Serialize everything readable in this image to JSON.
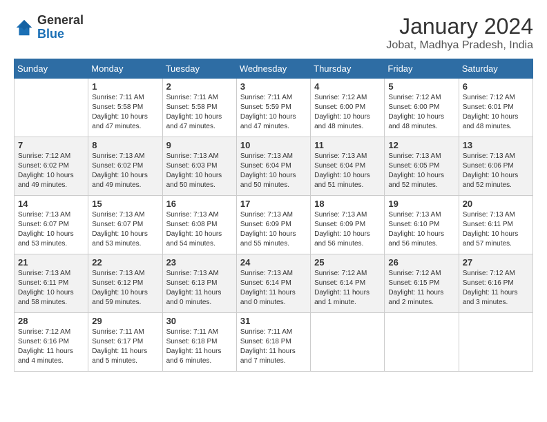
{
  "header": {
    "logo_general": "General",
    "logo_blue": "Blue",
    "month_title": "January 2024",
    "subtitle": "Jobat, Madhya Pradesh, India"
  },
  "days_of_week": [
    "Sunday",
    "Monday",
    "Tuesday",
    "Wednesday",
    "Thursday",
    "Friday",
    "Saturday"
  ],
  "weeks": [
    [
      {
        "day": "",
        "info": ""
      },
      {
        "day": "1",
        "info": "Sunrise: 7:11 AM\nSunset: 5:58 PM\nDaylight: 10 hours\nand 47 minutes."
      },
      {
        "day": "2",
        "info": "Sunrise: 7:11 AM\nSunset: 5:58 PM\nDaylight: 10 hours\nand 47 minutes."
      },
      {
        "day": "3",
        "info": "Sunrise: 7:11 AM\nSunset: 5:59 PM\nDaylight: 10 hours\nand 47 minutes."
      },
      {
        "day": "4",
        "info": "Sunrise: 7:12 AM\nSunset: 6:00 PM\nDaylight: 10 hours\nand 48 minutes."
      },
      {
        "day": "5",
        "info": "Sunrise: 7:12 AM\nSunset: 6:00 PM\nDaylight: 10 hours\nand 48 minutes."
      },
      {
        "day": "6",
        "info": "Sunrise: 7:12 AM\nSunset: 6:01 PM\nDaylight: 10 hours\nand 48 minutes."
      }
    ],
    [
      {
        "day": "7",
        "info": "Sunrise: 7:12 AM\nSunset: 6:02 PM\nDaylight: 10 hours\nand 49 minutes."
      },
      {
        "day": "8",
        "info": "Sunrise: 7:13 AM\nSunset: 6:02 PM\nDaylight: 10 hours\nand 49 minutes."
      },
      {
        "day": "9",
        "info": "Sunrise: 7:13 AM\nSunset: 6:03 PM\nDaylight: 10 hours\nand 50 minutes."
      },
      {
        "day": "10",
        "info": "Sunrise: 7:13 AM\nSunset: 6:04 PM\nDaylight: 10 hours\nand 50 minutes."
      },
      {
        "day": "11",
        "info": "Sunrise: 7:13 AM\nSunset: 6:04 PM\nDaylight: 10 hours\nand 51 minutes."
      },
      {
        "day": "12",
        "info": "Sunrise: 7:13 AM\nSunset: 6:05 PM\nDaylight: 10 hours\nand 52 minutes."
      },
      {
        "day": "13",
        "info": "Sunrise: 7:13 AM\nSunset: 6:06 PM\nDaylight: 10 hours\nand 52 minutes."
      }
    ],
    [
      {
        "day": "14",
        "info": "Sunrise: 7:13 AM\nSunset: 6:07 PM\nDaylight: 10 hours\nand 53 minutes."
      },
      {
        "day": "15",
        "info": "Sunrise: 7:13 AM\nSunset: 6:07 PM\nDaylight: 10 hours\nand 53 minutes."
      },
      {
        "day": "16",
        "info": "Sunrise: 7:13 AM\nSunset: 6:08 PM\nDaylight: 10 hours\nand 54 minutes."
      },
      {
        "day": "17",
        "info": "Sunrise: 7:13 AM\nSunset: 6:09 PM\nDaylight: 10 hours\nand 55 minutes."
      },
      {
        "day": "18",
        "info": "Sunrise: 7:13 AM\nSunset: 6:09 PM\nDaylight: 10 hours\nand 56 minutes."
      },
      {
        "day": "19",
        "info": "Sunrise: 7:13 AM\nSunset: 6:10 PM\nDaylight: 10 hours\nand 56 minutes."
      },
      {
        "day": "20",
        "info": "Sunrise: 7:13 AM\nSunset: 6:11 PM\nDaylight: 10 hours\nand 57 minutes."
      }
    ],
    [
      {
        "day": "21",
        "info": "Sunrise: 7:13 AM\nSunset: 6:11 PM\nDaylight: 10 hours\nand 58 minutes."
      },
      {
        "day": "22",
        "info": "Sunrise: 7:13 AM\nSunset: 6:12 PM\nDaylight: 10 hours\nand 59 minutes."
      },
      {
        "day": "23",
        "info": "Sunrise: 7:13 AM\nSunset: 6:13 PM\nDaylight: 11 hours\nand 0 minutes."
      },
      {
        "day": "24",
        "info": "Sunrise: 7:13 AM\nSunset: 6:14 PM\nDaylight: 11 hours\nand 0 minutes."
      },
      {
        "day": "25",
        "info": "Sunrise: 7:12 AM\nSunset: 6:14 PM\nDaylight: 11 hours\nand 1 minute."
      },
      {
        "day": "26",
        "info": "Sunrise: 7:12 AM\nSunset: 6:15 PM\nDaylight: 11 hours\nand 2 minutes."
      },
      {
        "day": "27",
        "info": "Sunrise: 7:12 AM\nSunset: 6:16 PM\nDaylight: 11 hours\nand 3 minutes."
      }
    ],
    [
      {
        "day": "28",
        "info": "Sunrise: 7:12 AM\nSunset: 6:16 PM\nDaylight: 11 hours\nand 4 minutes."
      },
      {
        "day": "29",
        "info": "Sunrise: 7:11 AM\nSunset: 6:17 PM\nDaylight: 11 hours\nand 5 minutes."
      },
      {
        "day": "30",
        "info": "Sunrise: 7:11 AM\nSunset: 6:18 PM\nDaylight: 11 hours\nand 6 minutes."
      },
      {
        "day": "31",
        "info": "Sunrise: 7:11 AM\nSunset: 6:18 PM\nDaylight: 11 hours\nand 7 minutes."
      },
      {
        "day": "",
        "info": ""
      },
      {
        "day": "",
        "info": ""
      },
      {
        "day": "",
        "info": ""
      }
    ]
  ]
}
